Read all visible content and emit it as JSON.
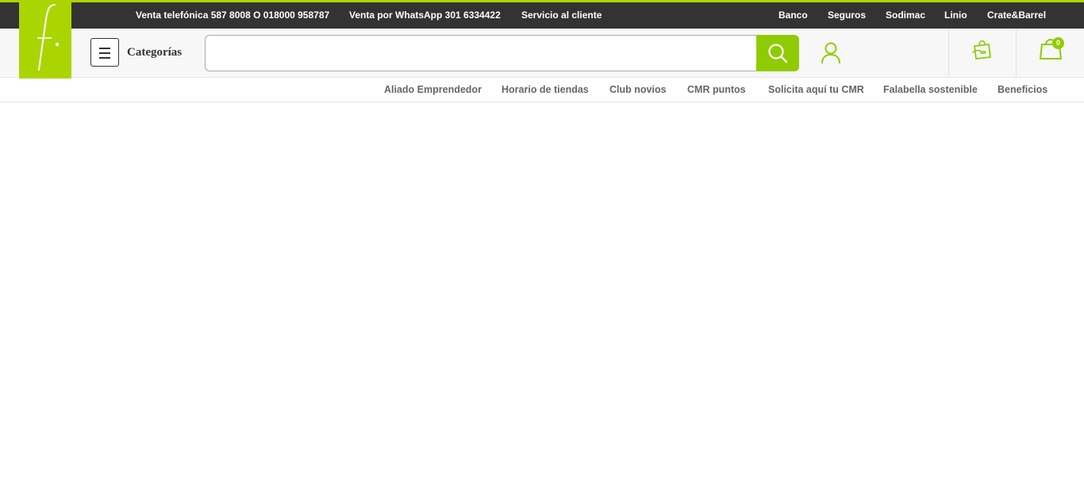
{
  "topbar": {
    "phone_sales": "Venta telefónica 587 8008 O 018000 958787",
    "whatsapp_sales": "Venta por WhatsApp 301 6334422",
    "customer_service": "Servicio al cliente",
    "right_links": [
      "Banco",
      "Seguros",
      "Sodimac",
      "Linio",
      "Crate&Barrel"
    ]
  },
  "logo": {
    "icon": "falabella-f-logo"
  },
  "header": {
    "categories_label": "Categorías",
    "search": {
      "value": "",
      "placeholder": ""
    },
    "cart_count": "0"
  },
  "subnav": {
    "links": [
      "Aliado Emprendedor",
      "Horario de tiendas",
      "Club novios",
      "CMR puntos",
      "Solicita aquí tu CMR",
      "Falabella sostenible",
      "Beneficios"
    ]
  },
  "colors": {
    "brand_green": "#aad500",
    "button_green": "#8fcb00",
    "topbar_bg": "#333333",
    "header_bg": "#f7f7f7"
  },
  "icons": [
    "menu-icon",
    "search-icon",
    "user-icon",
    "gift-bag-icon",
    "shopping-bag-icon"
  ]
}
